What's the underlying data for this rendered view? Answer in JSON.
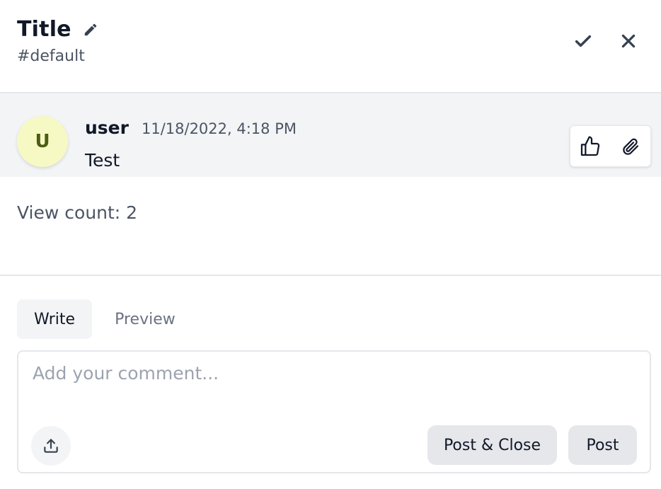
{
  "header": {
    "title": "Title",
    "channel": "#default"
  },
  "message": {
    "avatar_initial": "U",
    "user": "user",
    "timestamp": "11/18/2022, 4:18 PM",
    "body": "Test"
  },
  "view_count": "View count: 2",
  "composer": {
    "tabs": [
      "Write",
      "Preview"
    ],
    "active_tab": "Write",
    "placeholder": "Add your comment...",
    "value": "",
    "post_close_label": "Post & Close",
    "post_label": "Post"
  },
  "icons": {
    "edit": "pencil-icon",
    "resolve": "check-icon",
    "close": "close-icon",
    "like": "thumbs-up-icon",
    "attach": "paperclip-icon",
    "upload": "upload-icon"
  },
  "colors": {
    "avatar_bg": "#f7f9c4",
    "avatar_fg": "#4b5e12",
    "message_bg": "#f3f4f6",
    "button_bg": "#e5e7eb"
  }
}
